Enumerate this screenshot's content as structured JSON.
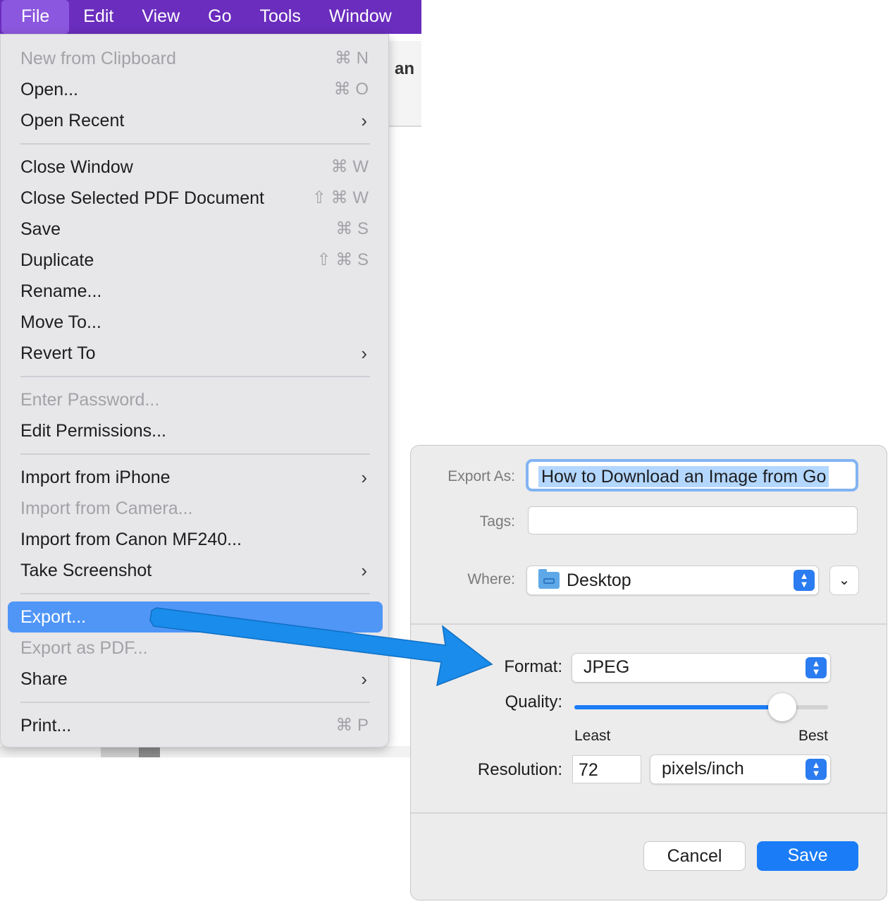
{
  "menubar": {
    "items": [
      "File",
      "Edit",
      "View",
      "Go",
      "Tools",
      "Window"
    ]
  },
  "background": {
    "partial_word": "an"
  },
  "file_menu": {
    "items": [
      {
        "label": "New from Clipboard",
        "shortcut": "⌘ N",
        "disabled": true
      },
      {
        "label": "Open...",
        "shortcut": "⌘ O"
      },
      {
        "label": "Open Recent",
        "submenu": true
      },
      {
        "label": "Close Window",
        "shortcut": "⌘ W"
      },
      {
        "label": "Close Selected PDF Document",
        "shortcut": "⇧ ⌘ W"
      },
      {
        "label": "Save",
        "shortcut": "⌘ S"
      },
      {
        "label": "Duplicate",
        "shortcut": "⇧ ⌘ S"
      },
      {
        "label": "Rename..."
      },
      {
        "label": "Move To..."
      },
      {
        "label": "Revert To",
        "submenu": true
      },
      {
        "label": "Enter Password...",
        "disabled": true
      },
      {
        "label": "Edit Permissions..."
      },
      {
        "label": "Import from iPhone",
        "submenu": true
      },
      {
        "label": "Import from Camera...",
        "disabled": true
      },
      {
        "label": "Import from Canon MF240..."
      },
      {
        "label": "Take Screenshot",
        "submenu": true
      },
      {
        "label": "Export...",
        "highlighted": true
      },
      {
        "label": "Export as PDF...",
        "disabled": true
      },
      {
        "label": "Share",
        "submenu": true
      },
      {
        "label": "Print...",
        "shortcut": "⌘ P"
      }
    ],
    "submenu_glyph": "›",
    "highlight_color": "#4f96f7"
  },
  "dialog": {
    "export_as_label": "Export As:",
    "export_as_value": "How to Download an Image from Go",
    "tags_label": "Tags:",
    "tags_value": "",
    "where_label": "Where:",
    "where_value": "Desktop",
    "format_label": "Format:",
    "format_value": "JPEG",
    "quality_label": "Quality:",
    "quality_level": 0.82,
    "quality_min_label": "Least",
    "quality_max_label": "Best",
    "resolution_label": "Resolution:",
    "resolution_value": "72",
    "resolution_unit": "pixels/inch",
    "cancel_label": "Cancel",
    "save_label": "Save",
    "accent_color": "#1a7cf6"
  },
  "annotation": {
    "arrow_color": "#1a8ceb",
    "icon": "callout-arrow"
  }
}
